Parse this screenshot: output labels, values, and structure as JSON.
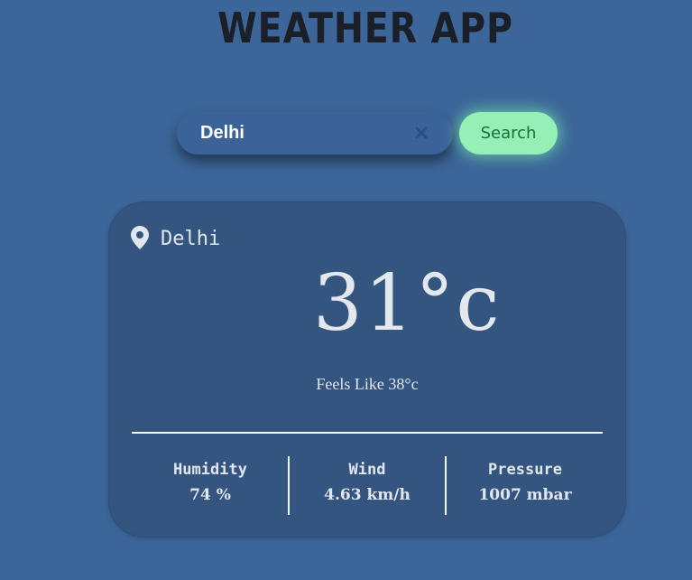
{
  "app": {
    "title": "WEATHER APP"
  },
  "search": {
    "value": "Delhi",
    "button_label": "Search",
    "clear_icon": "close-icon"
  },
  "weather": {
    "location_icon": "map-pin-icon",
    "location": "Delhi",
    "temperature": "31°c",
    "feels_like": "Feels Like 38°c",
    "stats": [
      {
        "label": "Humidity",
        "value": "74 %"
      },
      {
        "label": "Wind",
        "value": "4.63 km/h"
      },
      {
        "label": "Pressure",
        "value": "1007 mbar"
      }
    ]
  },
  "colors": {
    "background": "#3c6699",
    "card": "#33557f",
    "search_button": "#95f0b6",
    "title": "#1b1f27"
  }
}
